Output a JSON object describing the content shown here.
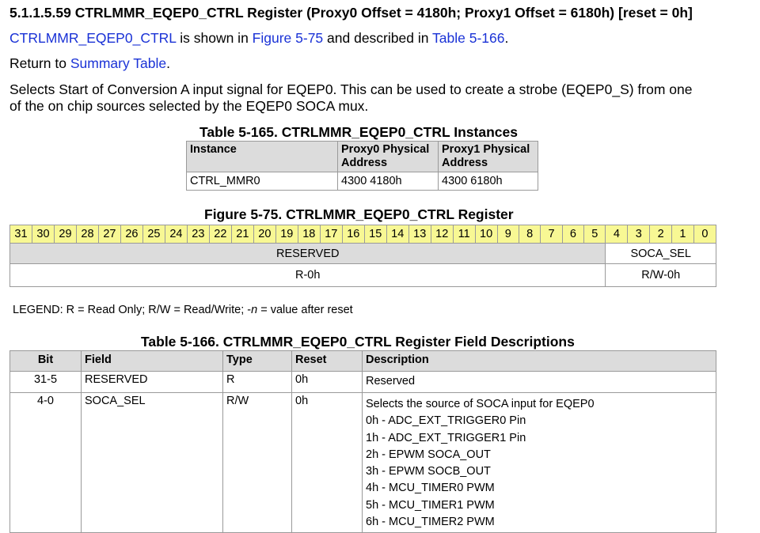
{
  "heading": "5.1.1.5.59 CTRLMMR_EQEP0_CTRL Register (Proxy0 Offset = 4180h; Proxy1 Offset = 6180h) [reset = 0h]",
  "intro": {
    "reg_link": "CTRLMMR_EQEP0_CTRL",
    "t1": " is shown in ",
    "fig_link": "Figure 5-75",
    "t2": " and described in ",
    "table_link": "Table 5-166",
    "t3": "."
  },
  "return": {
    "t1": "Return to ",
    "link": "Summary Table",
    "t2": "."
  },
  "description_line1": "Selects Start of Conversion A input signal for EQEP0. This can be used to create a strobe (EQEP0_S) from one",
  "description_line2": "of the on chip sources selected by the EQEP0 SOCA mux.",
  "instances_table": {
    "caption": "Table 5-165. CTRLMMR_EQEP0_CTRL Instances",
    "headers": [
      "Instance",
      "Proxy0 Physical Address",
      "Proxy1 Physical Address"
    ],
    "row": [
      "CTRL_MMR0",
      "4300 4180h",
      "4300 6180h"
    ]
  },
  "register_figure": {
    "caption": "Figure 5-75. CTRLMMR_EQEP0_CTRL Register",
    "bits": [
      "31",
      "30",
      "29",
      "28",
      "27",
      "26",
      "25",
      "24",
      "23",
      "22",
      "21",
      "20",
      "19",
      "18",
      "17",
      "16",
      "15",
      "14",
      "13",
      "12",
      "11",
      "10",
      "9",
      "8",
      "7",
      "6",
      "5",
      "4",
      "3",
      "2",
      "1",
      "0"
    ],
    "fields": [
      "RESERVED",
      "SOCA_SEL"
    ],
    "resets": [
      "R-0h",
      "R/W-0h"
    ]
  },
  "legend": {
    "t1": "LEGEND: R = Read Only; R/W = Read/Write; -",
    "n": "n",
    "t2": " = value after reset"
  },
  "field_table": {
    "caption": "Table 5-166. CTRLMMR_EQEP0_CTRL Register Field Descriptions",
    "headers": [
      "Bit",
      "Field",
      "Type",
      "Reset",
      "Description"
    ],
    "row1": [
      "31-5",
      "RESERVED",
      "R",
      "0h",
      "Reserved"
    ],
    "row2": [
      "4-0",
      "SOCA_SEL",
      "R/W",
      "0h"
    ],
    "row2_desc": [
      "Selects the source of SOCA input for EQEP0",
      "0h - ADC_EXT_TRIGGER0 Pin",
      "1h - ADC_EXT_TRIGGER1 Pin",
      "2h - EPWM SOCA_OUT",
      "3h - EPWM SOCB_OUT",
      "4h - MCU_TIMER0 PWM",
      "5h - MCU_TIMER1 PWM",
      "6h - MCU_TIMER2 PWM"
    ]
  }
}
